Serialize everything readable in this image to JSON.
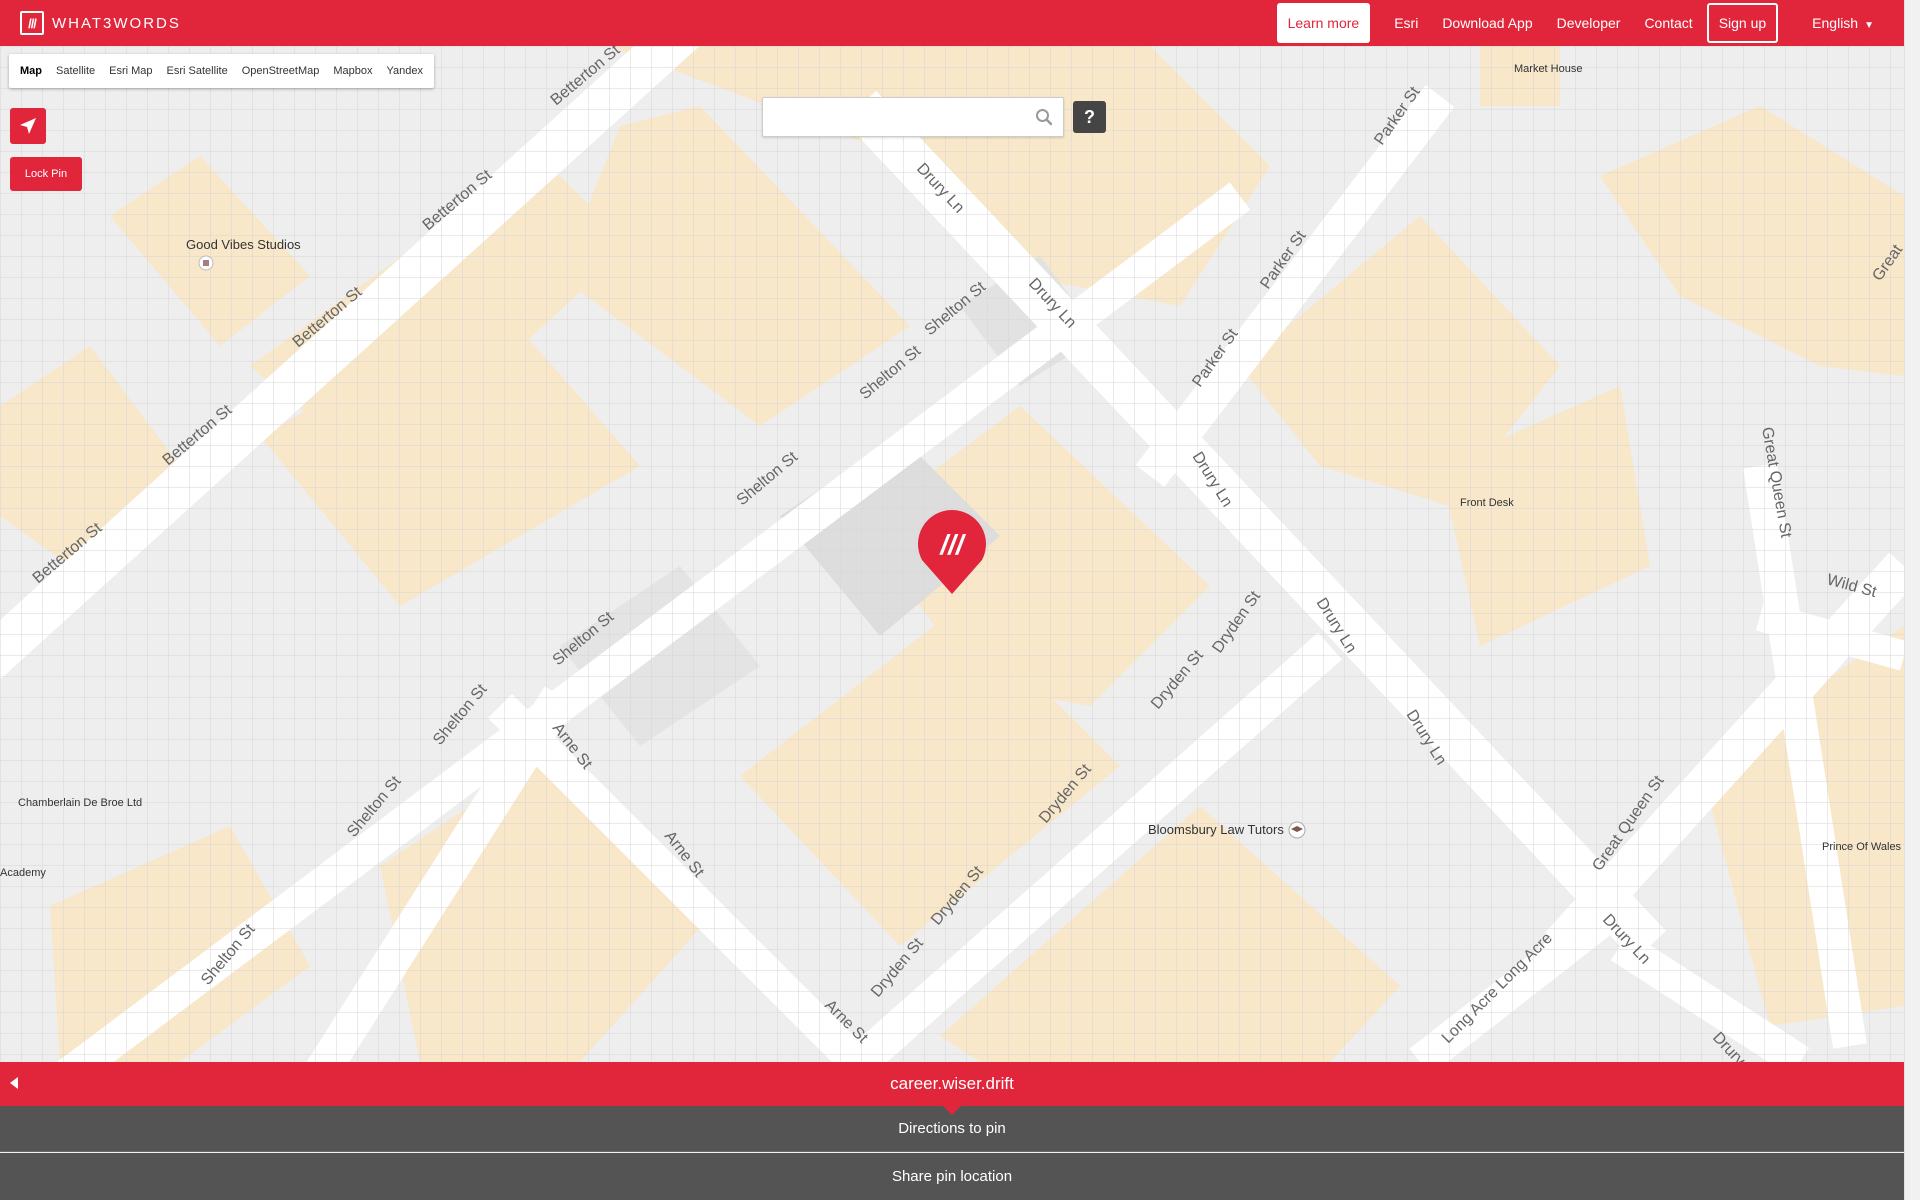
{
  "header": {
    "logo_mark": "///",
    "logo_text": "WHAT3WORDS",
    "learn_more": "Learn more",
    "nav": [
      "Esri",
      "Download App",
      "Developer",
      "Contact"
    ],
    "sign_up": "Sign up",
    "language": "English",
    "language_caret": "▼"
  },
  "map_types": [
    "Map",
    "Satellite",
    "Esri Map",
    "Esri Satellite",
    "OpenStreetMap",
    "Mapbox",
    "Yandex"
  ],
  "controls": {
    "lock_pin": "Lock Pin",
    "help": "?",
    "search_placeholder": "",
    "search_value": ""
  },
  "map": {
    "pin_glyph": "///",
    "streets": {
      "betterton_1": "Betterton St",
      "betterton_2": "Betterton St",
      "betterton_3": "Betterton St",
      "betterton_4": "Betterton St",
      "betterton_5": "Betterton St",
      "shelton_1": "Shelton St",
      "shelton_2": "Shelton St",
      "shelton_3": "Shelton St",
      "shelton_4": "Shelton St",
      "shelton_5": "Shelton St",
      "shelton_6": "Shelton St",
      "shelton_7": "Shelton St",
      "drury_1": "Drury Ln",
      "drury_2": "Drury Ln",
      "drury_3": "Drury Ln",
      "drury_4": "Drury Ln",
      "drury_5": "Drury Ln",
      "drury_6": "Drury Ln",
      "drury_7": "Drury",
      "parker_1": "Parker St",
      "parker_2": "Parker St",
      "parker_3": "Parker St",
      "dryden_1": "Dryden St",
      "dryden_2": "Dryden St",
      "dryden_3": "Dryden St",
      "dryden_4": "Dryden St",
      "dryden_5": "Dryden St",
      "arne_1": "Arne St",
      "arne_2": "Arne St",
      "arne_3": "Arne St",
      "great_queen_1": "Great Queen St",
      "great_queen_2": "Great Queen St",
      "great_queen_3": "Great",
      "wild": "Wild St",
      "long_acre": "Long Acre Long Acre"
    },
    "pois": {
      "good_vibes": "Good Vibes Studios",
      "market_house": "Market House",
      "front_desk": "Front Desk",
      "chamberlain": "Chamberlain De Broe Ltd",
      "academy": "Academy",
      "bloomsbury": "Bloomsbury Law Tutors",
      "prince_of_wales": "Prince Of Wales"
    }
  },
  "panel": {
    "address": "career.wiser.drift",
    "directions": "Directions to pin",
    "share": "Share pin location"
  },
  "colors": {
    "brand_red": "#e1253a",
    "panel_dark": "#545454",
    "building": "#f8e7c9",
    "road": "#ffffff",
    "block": "#e6e6e6"
  }
}
